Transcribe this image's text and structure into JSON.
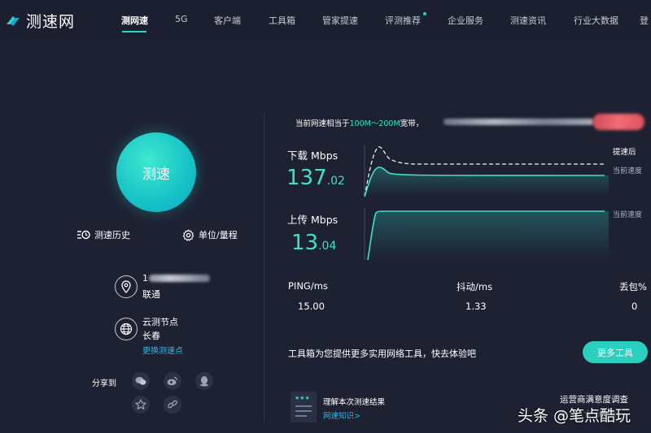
{
  "brand": {
    "name": "测速网",
    "accent": "#2bd6c0"
  },
  "nav": {
    "items": [
      "测网速",
      "5G",
      "客户端",
      "工具箱",
      "管家提速",
      "评测推荐",
      "企业服务",
      "测速资讯",
      "行业大数据",
      "登"
    ],
    "active_index": 0
  },
  "left": {
    "start_label": "测速",
    "history_label": "测速历史",
    "unit_label": "单位/量程",
    "ip_prefix": "1",
    "isp": "联通",
    "node_title": "云测节点",
    "node_city": "长春",
    "change_node": "更换测速点",
    "share_label": "分享到",
    "share_icons": [
      "wechat-icon",
      "weibo-icon",
      "qq-icon",
      "qzone-icon",
      "link-icon"
    ]
  },
  "hint": {
    "prefix": "当前网速相当于",
    "range": "100M～200M",
    "suffix": "宽带，"
  },
  "download": {
    "label": "下载 Mbps",
    "int": "137",
    "dec": ".02"
  },
  "upload": {
    "label": "上传 Mbps",
    "int": "13",
    "dec": ".04"
  },
  "legend": {
    "after_boost": "提速后",
    "current_speed": "当前速度"
  },
  "stats": {
    "ping_label": "PING/ms",
    "ping": "15.00",
    "jitter_label": "抖动/ms",
    "jitter": "1.33",
    "loss_label": "丢包%",
    "loss": "0"
  },
  "tools": {
    "text": "工具箱为您提供更多实用网络工具，快去体验吧",
    "button": "更多工具"
  },
  "card": {
    "title": "理解本次测速结果",
    "link": "网速知识>"
  },
  "survey": {
    "title": "运营商满意度调查",
    "stars": "★★★★★"
  },
  "watermark": "头条 @笔点酷玩"
}
